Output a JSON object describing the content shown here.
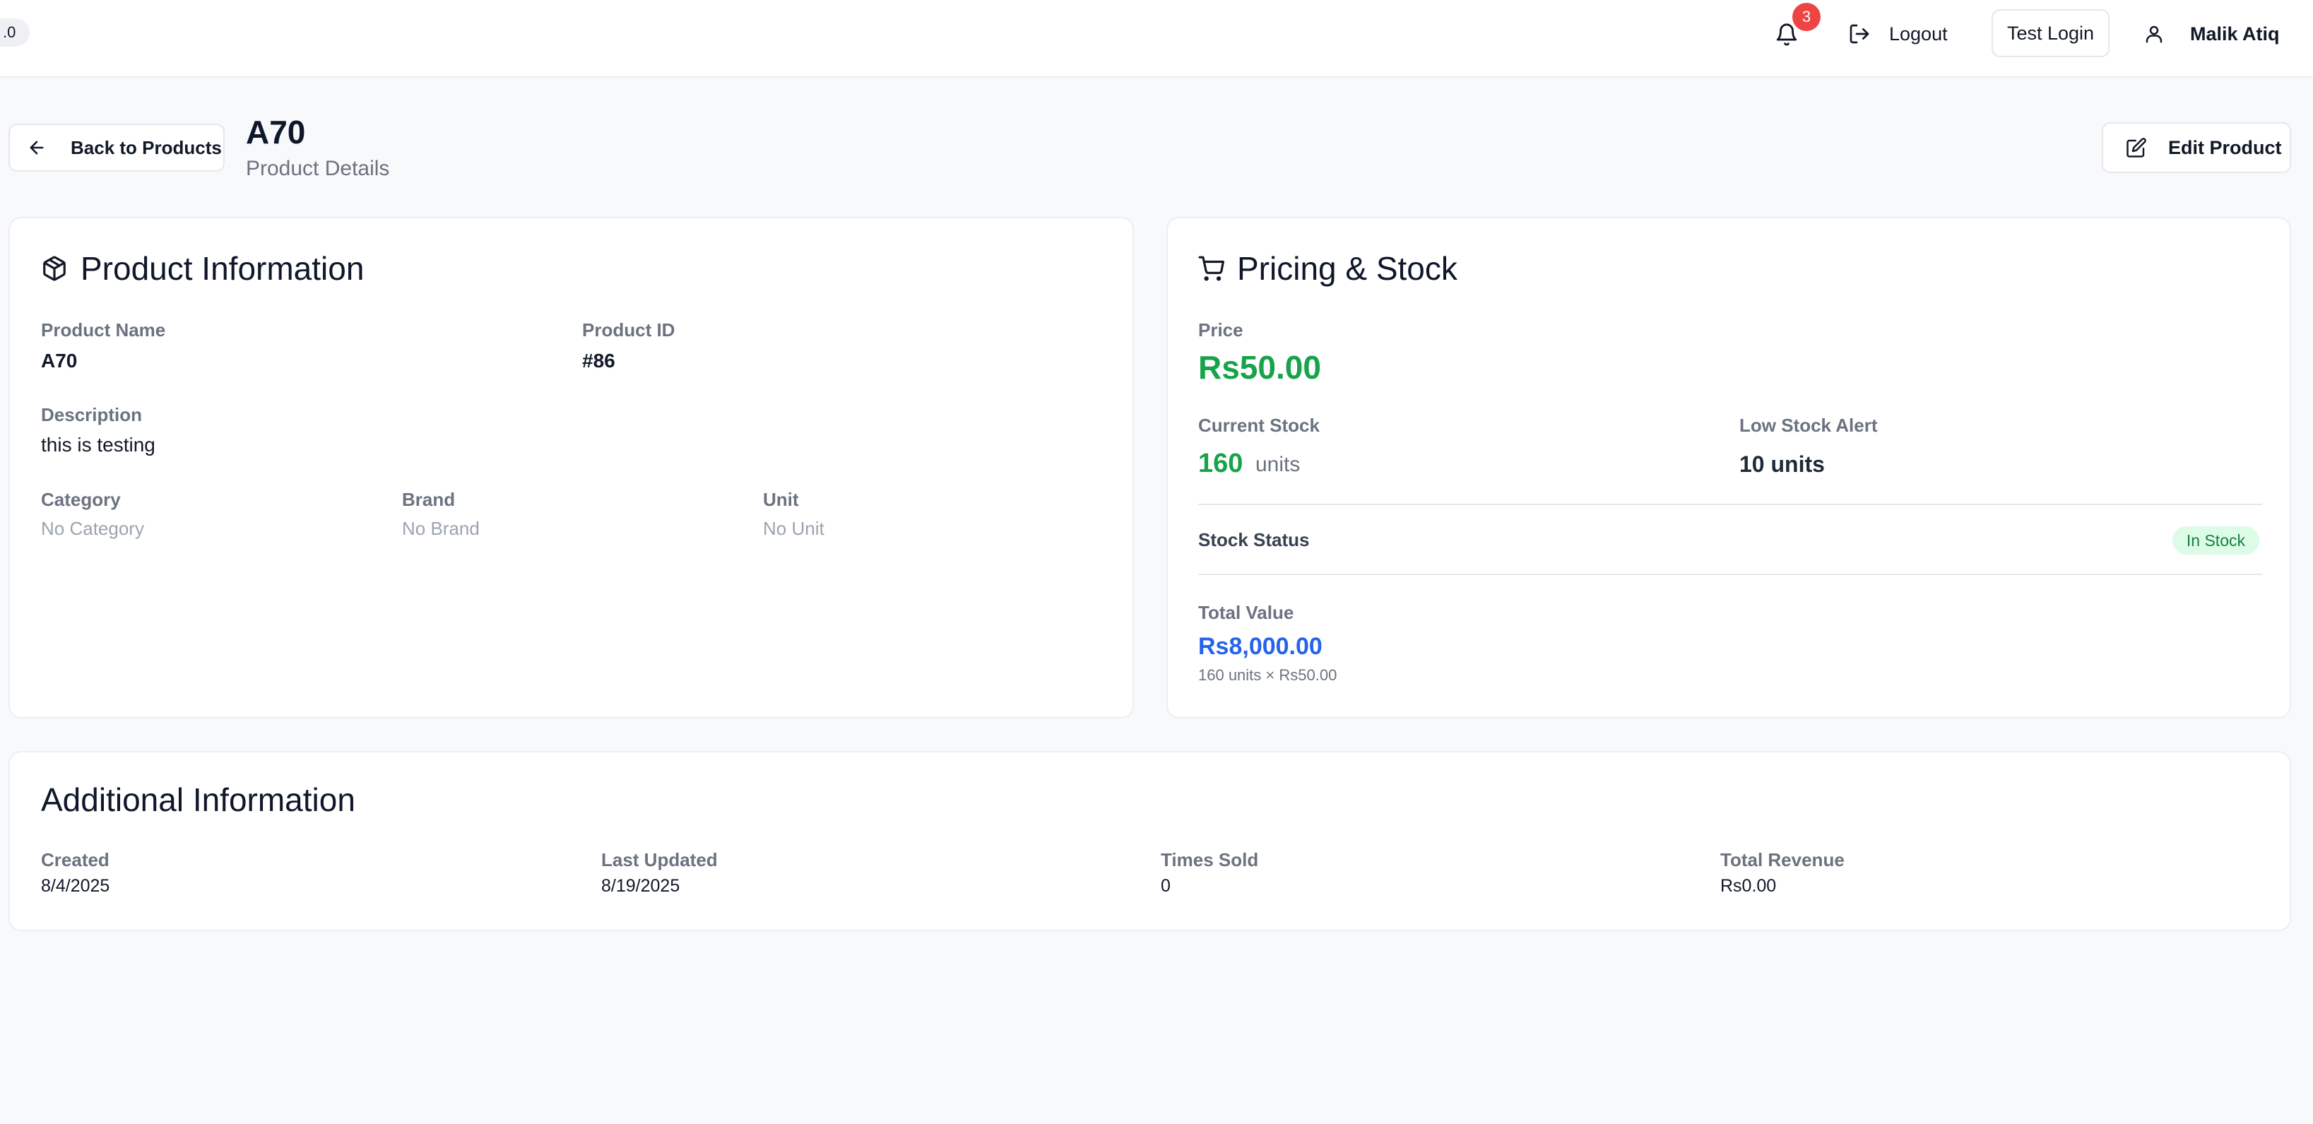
{
  "header": {
    "version_badge": ".0",
    "notification_count": "3",
    "logout_label": "Logout",
    "test_login_label": "Test Login",
    "user_name": "Malik Atiq"
  },
  "page": {
    "back_label": "Back to Products",
    "title": "A70",
    "subtitle": "Product Details",
    "edit_label": "Edit Product"
  },
  "product_info": {
    "title": "Product Information",
    "name_label": "Product Name",
    "name_value": "A70",
    "id_label": "Product ID",
    "id_value": "#86",
    "description_label": "Description",
    "description_value": "this is testing",
    "category_label": "Category",
    "category_value": "No Category",
    "brand_label": "Brand",
    "brand_value": "No Brand",
    "unit_label": "Unit",
    "unit_value": "No Unit"
  },
  "pricing": {
    "title": "Pricing & Stock",
    "price_label": "Price",
    "price_value": "Rs50.00",
    "current_stock_label": "Current Stock",
    "current_stock_value": "160",
    "current_stock_unit": "units",
    "low_stock_label": "Low Stock Alert",
    "low_stock_value": "10 units",
    "stock_status_label": "Stock Status",
    "stock_status_value": "In Stock",
    "total_value_label": "Total Value",
    "total_value": "Rs8,000.00",
    "total_calc": "160 units × Rs50.00"
  },
  "additional": {
    "title": "Additional Information",
    "created_label": "Created",
    "created_value": "8/4/2025",
    "updated_label": "Last Updated",
    "updated_value": "8/19/2025",
    "times_sold_label": "Times Sold",
    "times_sold_value": "0",
    "revenue_label": "Total Revenue",
    "revenue_value": "Rs0.00"
  },
  "colors": {
    "accent_green": "#16a34a",
    "accent_blue": "#2563eb",
    "badge_red": "#ef4444",
    "in_stock_bg": "#dcfce7"
  },
  "icons": [
    "bell-icon",
    "logout-icon",
    "user-icon",
    "arrow-left-icon",
    "edit-icon",
    "package-icon",
    "cart-icon"
  ]
}
